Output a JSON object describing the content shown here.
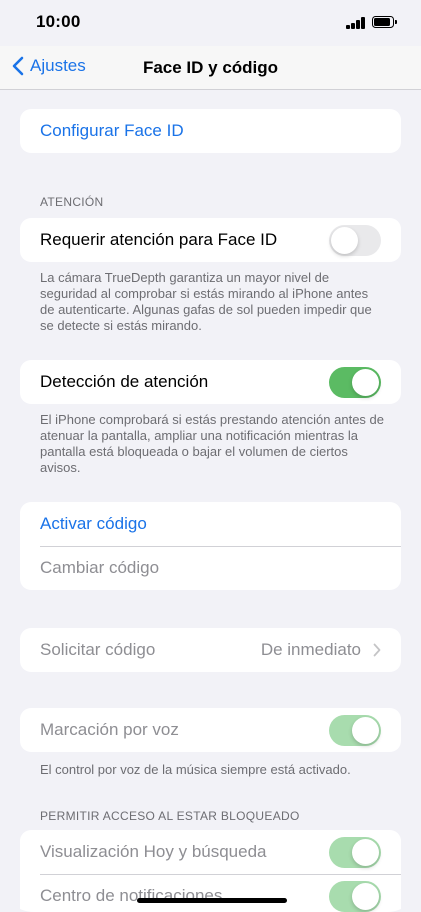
{
  "status_bar": {
    "time": "10:00"
  },
  "nav": {
    "back_label": "Ajustes",
    "title": "Face ID y código"
  },
  "setup_face_id": "Configurar Face ID",
  "attention": {
    "header": "ATENCIÓN",
    "require_label": "Requerir atención para Face ID",
    "require_on": false,
    "require_footer": "La cámara TrueDepth garantiza un mayor nivel de seguridad al comprobar si estás mirando al iPhone antes de autenticarte. Algunas gafas de sol pueden impedir que se detecte si estás mirando.",
    "detection_label": "Detección de atención",
    "detection_on": true,
    "detection_footer": "El iPhone comprobará si estás prestando atención antes de atenuar la pantalla, ampliar una notificación mientras la pantalla está bloqueada o bajar el volumen de ciertos avisos."
  },
  "passcode": {
    "activate_label": "Activar código",
    "change_label": "Cambiar código"
  },
  "require_passcode": {
    "label": "Solicitar código",
    "value": "De inmediato"
  },
  "voice_dial": {
    "label": "Marcación por voz",
    "on": true,
    "footer": "El control por voz de la música siempre está activado."
  },
  "locked_access": {
    "header": "PERMITIR ACCESO AL ESTAR BLOQUEADO",
    "items": [
      {
        "label": "Visualización Hoy y búsqueda",
        "on": true
      },
      {
        "label": "Centro de notificaciones",
        "on": true
      }
    ]
  },
  "colors": {
    "accent": "#1a73e8",
    "toggle_on": "#5bbb63",
    "toggle_disabled_on": "#a8dcae",
    "background": "#f2f2f7"
  }
}
